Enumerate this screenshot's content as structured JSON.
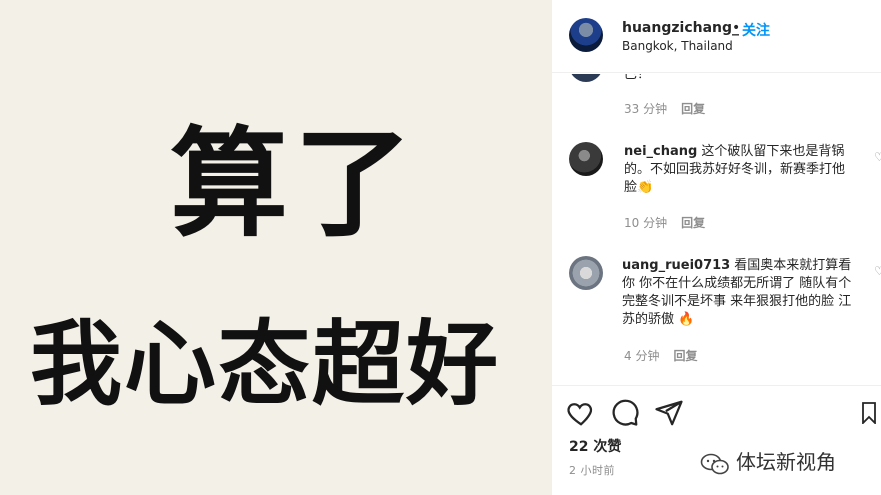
{
  "image": {
    "line1": "算了",
    "line2": "我心态超好"
  },
  "header": {
    "username": "huangzichang_",
    "separator": "•",
    "follow_label": "关注",
    "location": "Bangkok, Thailand"
  },
  "comments": [
    {
      "text": "巴！",
      "time": "33 分钟",
      "reply": "回复"
    },
    {
      "username": "nei_chang",
      "text": "这个破队留下来也是背锅的。不如回我苏好好冬训，新赛季打他脸👏",
      "time": "10 分钟",
      "reply": "回复"
    },
    {
      "username": "uang_ruei0713",
      "text": "看国奥本来就打算看你 你不在什么成绩都无所谓了 随队有个完整冬训不是坏事 来年狠狠打他的脸 江苏的骄傲 🔥",
      "time": "4 分钟",
      "reply": "回复"
    }
  ],
  "actions": {
    "likes": "22 次赞",
    "time_ago": "2 小时前",
    "icons": [
      "heart-icon",
      "comment-icon",
      "share-icon",
      "bookmark-icon"
    ]
  },
  "watermark": {
    "text": "体坛新视角"
  },
  "colors": {
    "follow": "#0095f6",
    "image_bg": "#f3f0e8",
    "muted": "#8e8e8e"
  }
}
